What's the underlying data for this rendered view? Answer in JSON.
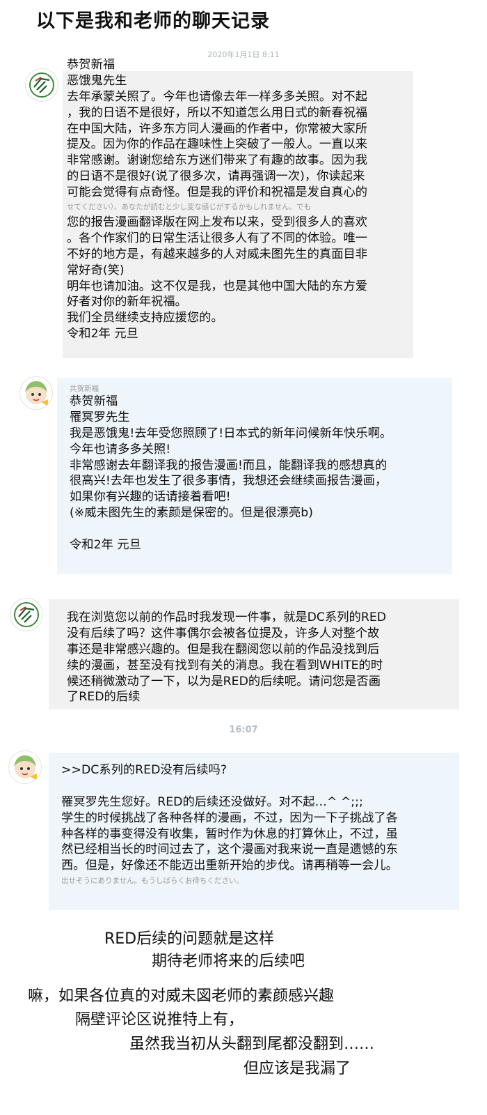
{
  "page_title": "以下是我和老师的聊天记录",
  "chat": {
    "timestamp_1": "2020年1月1日 8:11",
    "timestamp_2": "16:07",
    "messages": [
      {
        "lines": [
          "恭贺新福",
          "恶饿鬼先生",
          "去年承蒙关照了。今年也请像去年一样多多关照。对不起",
          "，我的日语不是很好，所以不知道怎么用日式的新春祝福",
          "在中国大陆，许多东方同人漫画的作者中，你常被大家所",
          "提及。因为你的作品在趣味性上突破了一般人。一直以来",
          "非常感谢。谢谢您给东方迷们带来了有趣的故事。因为我",
          "的日语不是很好(说了很多次，请再强调一次)，你读起来",
          "可能会觉得有点奇怪。但是我的评价和祝福是发自真心的"
        ],
        "ghost": "せてください）、あなたが読むと少し変な感じがするかもしれません。でも",
        "lines_b": [
          "您的报告漫画翻译版在网上发布以来，受到很多人的喜欢",
          "。各个作家们的日常生活让很多人有了不同的体验。唯一",
          "不好的地方是，有越来越多的人对威未图先生的真面目非",
          "常好奇(笑)",
          "明年也请加油。这不仅是我，也是其他中国大陆的东方爱",
          "好者对你的新年祝福。",
          "我们全员继续支持应援您的。",
          "令和2年  元旦"
        ]
      },
      {
        "ghost": "共贺新福",
        "lines": [
          "恭贺新福",
          "罹冥罗先生",
          "我是恶饿鬼!去年受您照顾了!日本式的新年问候新年快乐啊。",
          "今年也请多多关照!",
          "非常感谢去年翻译我的报告漫画!而且，能翻译我的感想真的",
          "很高兴!去年也发生了很多事情，我想还会继续画报告漫画，",
          "如果你有兴趣的话请接着看吧!",
          "(※威未图先生的素颜是保密的。但是很漂亮b)",
          "",
          "令和2年  元旦"
        ]
      },
      {
        "lines": [
          "我在浏览您以前的作品时我发现一件事，就是DC系列的RED",
          "没有后续了吗？这件事偶尔会被各位提及，许多人对整个故",
          "事还是非常感兴趣的。但是我在翻阅您以前的作品没找到后",
          "续的漫画，甚至没有找到有关的消息。我在看到WHITE的时",
          "候还稍微激动了一下，以为是RED的后续呢。请问您是否画",
          "了RED的后续"
        ]
      },
      {
        "lines": [
          ">>DC系列的RED没有后续吗?",
          "",
          "罹冥罗先生您好。RED的后续还没做好。对不起…^ ^;;;",
          "学生的时候挑战了各种各样的漫画，不过，因为一下子挑战了各",
          "种各样的事变得没有收集，暂时作为休息的打算休止，不过，虽",
          "然已经相当长的时间过去了，这个漫画对我来说一直是遗憾的东",
          "西。但是，好像还不能迈出重新开始的步伐。请再稍等一会儿。"
        ],
        "ghost": "出せそうにありません。もうしばらくお待ちください。"
      }
    ]
  },
  "comments": [
    "RED后续的问题就是这样",
    "期待老师将来的后续吧",
    "嘛，如果各位真的对威未図老师的素颜感兴趣",
    "隔壁评论区说推特上有，",
    "虽然我当初从头翻到尾都没翻到……",
    "但应该是我漏了"
  ],
  "colors": {
    "left_bubble": "#f1f1f1",
    "right_bubble": "#eef5fb",
    "timestamp": "#a9b3bd"
  },
  "icons": {
    "avatar_left": "pen-sketch-avatar-icon",
    "avatar_right": "green-hair-character-avatar-icon"
  }
}
